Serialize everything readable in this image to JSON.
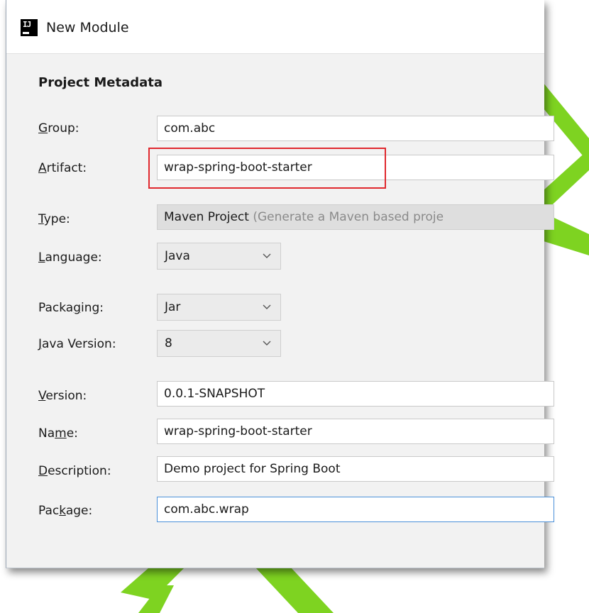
{
  "window": {
    "title": "New Module",
    "icon_text": "IJ",
    "icon": "intellij-icon"
  },
  "section_title": "Project Metadata",
  "fields": {
    "group": {
      "label_pre": "",
      "mnemonic": "G",
      "label_post": "roup:",
      "value": "com.abc"
    },
    "artifact": {
      "label_pre": "",
      "mnemonic": "A",
      "label_post": "rtifact:",
      "value": "wrap-spring-boot-starter"
    },
    "type": {
      "label_pre": "",
      "mnemonic": "T",
      "label_post": "ype:",
      "value": "Maven Project",
      "hint": "(Generate a Maven based proje"
    },
    "language": {
      "label_pre": "",
      "mnemonic": "L",
      "label_post": "anguage:",
      "value": "Java"
    },
    "packaging": {
      "label_pre": "Packa",
      "mnemonic": "g",
      "label_post": "ing:",
      "value": "Jar"
    },
    "java_version": {
      "label_pre": "",
      "mnemonic": "J",
      "label_post": "ava Version:",
      "value": "8"
    },
    "version": {
      "label_pre": "",
      "mnemonic": "V",
      "label_post": "ersion:",
      "value": "0.0.1-SNAPSHOT"
    },
    "name": {
      "label_pre": "Na",
      "mnemonic": "m",
      "label_post": "e:",
      "value": "wrap-spring-boot-starter"
    },
    "description": {
      "label_pre": "",
      "mnemonic": "D",
      "label_post": "escription:",
      "value": "Demo project for Spring Boot"
    },
    "package": {
      "label_pre": "Pac",
      "mnemonic": "k",
      "label_post": "age:",
      "value": "com.abc.wrap"
    }
  },
  "colors": {
    "highlight": "#e0282e",
    "focus_border": "#4a90d9",
    "watermark": "#7ed321"
  }
}
